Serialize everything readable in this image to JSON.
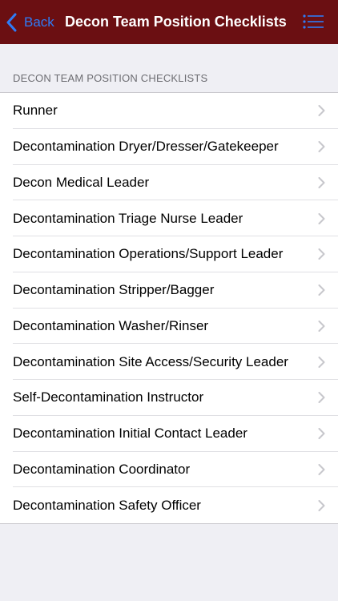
{
  "nav": {
    "back_label": "Back",
    "title": "Decon Team Position Checklists",
    "back_icon": "chevron-left-icon",
    "menu_icon": "list-icon",
    "bar_color": "#6b0f12",
    "accent_color": "#2f7cf6"
  },
  "section": {
    "header": "DECON TEAM POSITION CHECKLISTS"
  },
  "items": [
    {
      "label": "Runner"
    },
    {
      "label": "Decontamination Dryer/Dresser/Gatekeeper"
    },
    {
      "label": "Decon Medical Leader"
    },
    {
      "label": "Decontamination Triage Nurse Leader"
    },
    {
      "label": "Decontamination Operations/Support Leader"
    },
    {
      "label": "Decontamination Stripper/Bagger"
    },
    {
      "label": "Decontamination Washer/Rinser"
    },
    {
      "label": "Decontamination Site Access/Security Leader"
    },
    {
      "label": "Self-Decontamination Instructor"
    },
    {
      "label": "Decontamination Initial Contact Leader"
    },
    {
      "label": "Decontamination Coordinator"
    },
    {
      "label": "Decontamination Safety Officer"
    }
  ]
}
